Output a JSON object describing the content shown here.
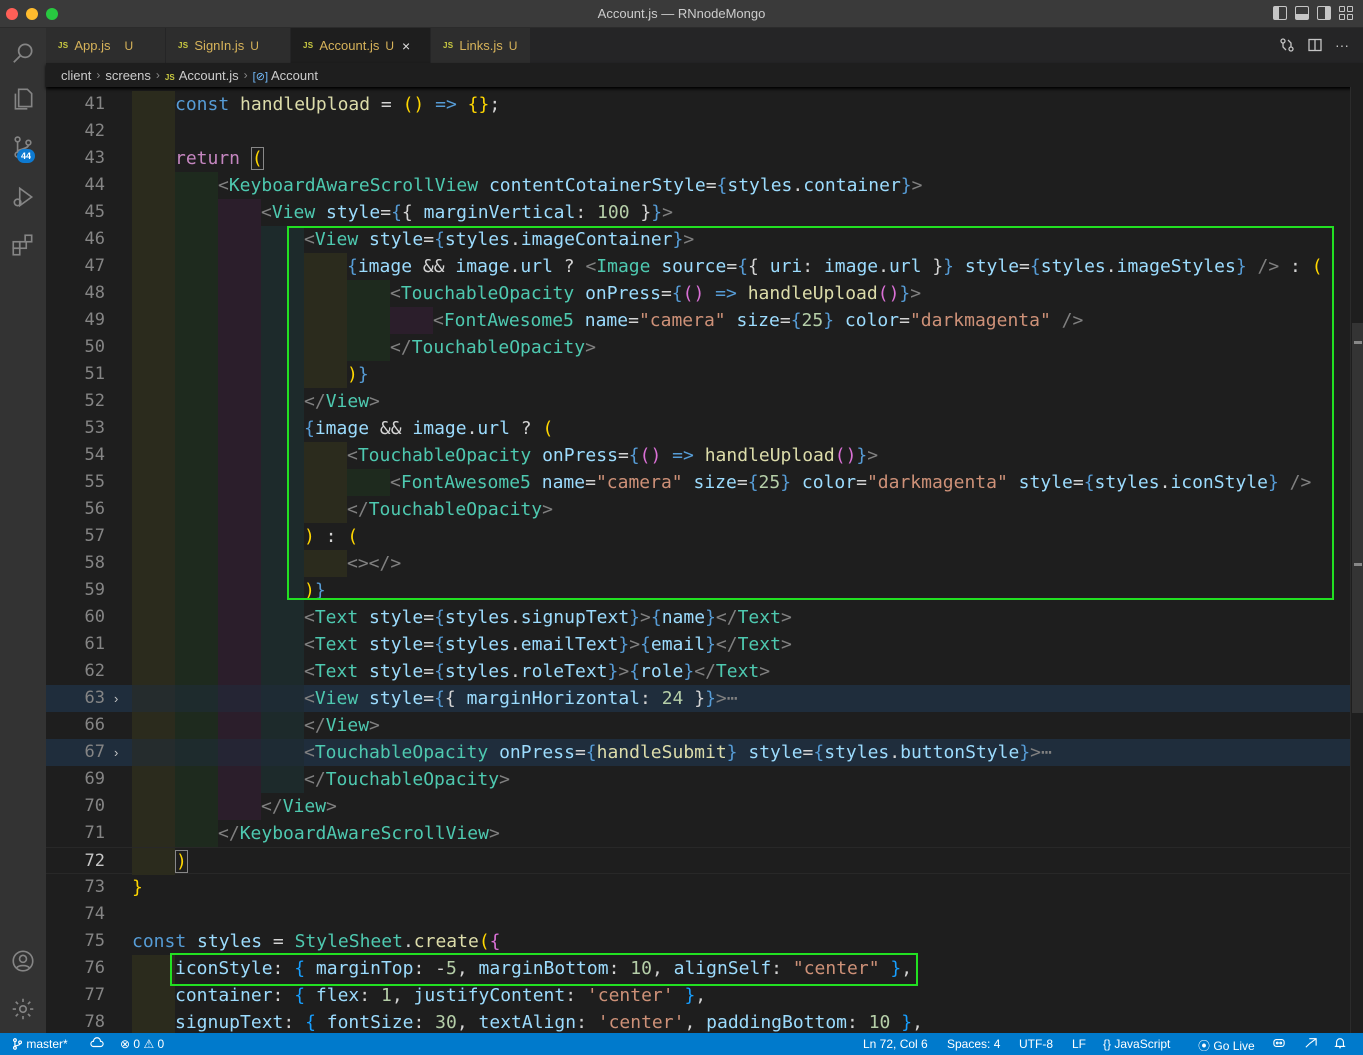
{
  "window": {
    "title": "Account.js — RNnodeMongo"
  },
  "activity_bar": {
    "scm_badge": "44",
    "items": [
      "explorer",
      "search",
      "source-control",
      "run-debug",
      "extensions",
      "accounts",
      "manage"
    ]
  },
  "tabs": [
    {
      "badge": "JS",
      "name": "App.js",
      "mod": "U"
    },
    {
      "badge": "JS",
      "name": "SignIn.js",
      "mod": "U"
    },
    {
      "badge": "JS",
      "name": "Account.js",
      "mod": "U",
      "active": true,
      "close": "×"
    },
    {
      "badge": "JS",
      "name": "Links.js",
      "mod": "U"
    }
  ],
  "tab_actions": {
    "more": "···"
  },
  "breadcrumb": {
    "seg1": "client",
    "seg2": "screens",
    "badge": "JS",
    "seg3": "Account.js",
    "sym_icon": "[⊘]",
    "seg4": "Account",
    "sep": "›"
  },
  "editor": {
    "lines": [
      {
        "n": "41"
      },
      {
        "n": "42"
      },
      {
        "n": "43"
      },
      {
        "n": "44"
      },
      {
        "n": "45"
      },
      {
        "n": "46"
      },
      {
        "n": "47"
      },
      {
        "n": "48"
      },
      {
        "n": "49"
      },
      {
        "n": "50"
      },
      {
        "n": "51"
      },
      {
        "n": "52"
      },
      {
        "n": "53"
      },
      {
        "n": "54"
      },
      {
        "n": "55"
      },
      {
        "n": "56"
      },
      {
        "n": "57"
      },
      {
        "n": "58"
      },
      {
        "n": "59"
      },
      {
        "n": "60"
      },
      {
        "n": "61"
      },
      {
        "n": "62"
      },
      {
        "n": "63"
      },
      {
        "n": "66"
      },
      {
        "n": "67"
      },
      {
        "n": "69"
      },
      {
        "n": "70"
      },
      {
        "n": "71"
      },
      {
        "n": "72"
      },
      {
        "n": "73"
      },
      {
        "n": "74"
      },
      {
        "n": "75"
      },
      {
        "n": "76"
      },
      {
        "n": "77"
      },
      {
        "n": "78"
      }
    ],
    "fold_glyph": "›",
    "folded_ellipsis": "⋯"
  },
  "status": {
    "branch": "master*",
    "errors": "0",
    "warnings": "0",
    "position": "Ln 72, Col 6",
    "spaces": "Spaces: 4",
    "encoding": "UTF-8",
    "eol": "LF",
    "language": "JavaScript",
    "golive": "Go Live"
  },
  "colors": {
    "accent": "#007acc",
    "annotation": "#22e022"
  }
}
